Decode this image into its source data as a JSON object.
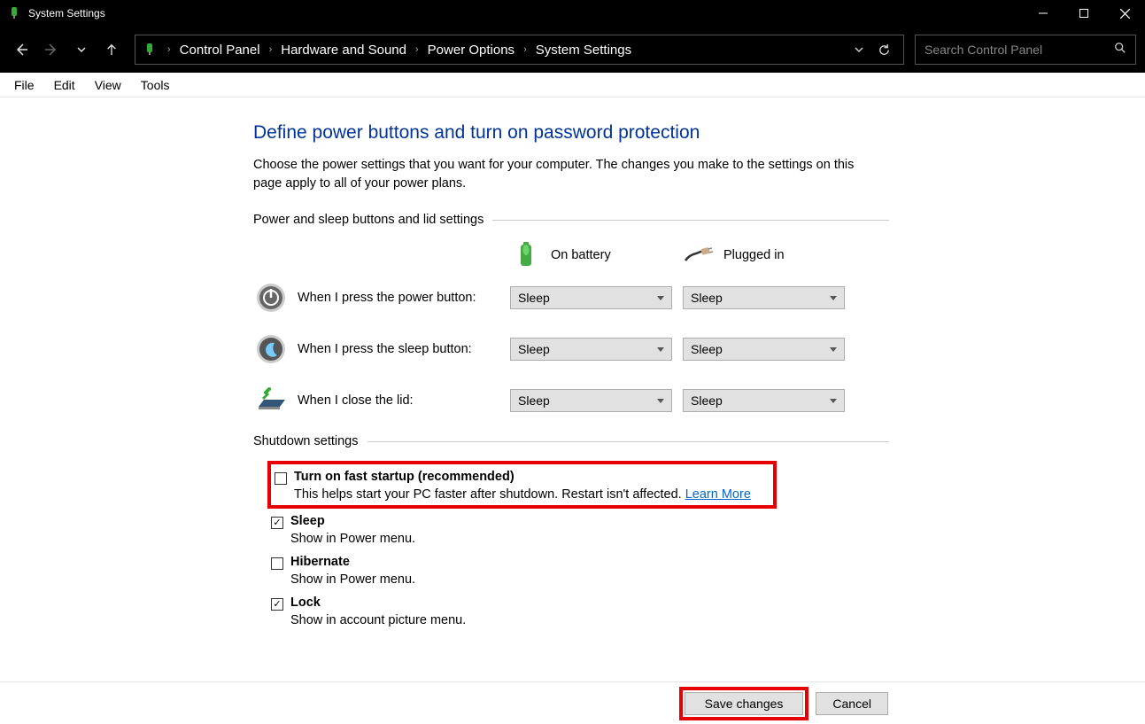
{
  "window": {
    "title": "System Settings"
  },
  "breadcrumbs": [
    "Control Panel",
    "Hardware and Sound",
    "Power Options",
    "System Settings"
  ],
  "search": {
    "placeholder": "Search Control Panel"
  },
  "menu": [
    "File",
    "Edit",
    "View",
    "Tools"
  ],
  "page": {
    "title": "Define power buttons and turn on password protection",
    "desc": "Choose the power settings that you want for your computer. The changes you make to the settings on this page apply to all of your power plans."
  },
  "section1": {
    "heading": "Power and sleep buttons and lid settings",
    "col_battery": "On battery",
    "col_plugged": "Plugged in",
    "rows": [
      {
        "label": "When I press the power button:",
        "battery": "Sleep",
        "plugged": "Sleep"
      },
      {
        "label": "When I press the sleep button:",
        "battery": "Sleep",
        "plugged": "Sleep"
      },
      {
        "label": "When I close the lid:",
        "battery": "Sleep",
        "plugged": "Sleep"
      }
    ]
  },
  "section2": {
    "heading": "Shutdown settings",
    "fast_startup": {
      "label": "Turn on fast startup (recommended)",
      "desc": "This helps start your PC faster after shutdown. Restart isn't affected. ",
      "link": "Learn More",
      "checked": false
    },
    "sleep": {
      "label": "Sleep",
      "desc": "Show in Power menu.",
      "checked": true
    },
    "hibernate": {
      "label": "Hibernate",
      "desc": "Show in Power menu.",
      "checked": false
    },
    "lock": {
      "label": "Lock",
      "desc": "Show in account picture menu.",
      "checked": true
    }
  },
  "buttons": {
    "save": "Save changes",
    "cancel": "Cancel"
  }
}
